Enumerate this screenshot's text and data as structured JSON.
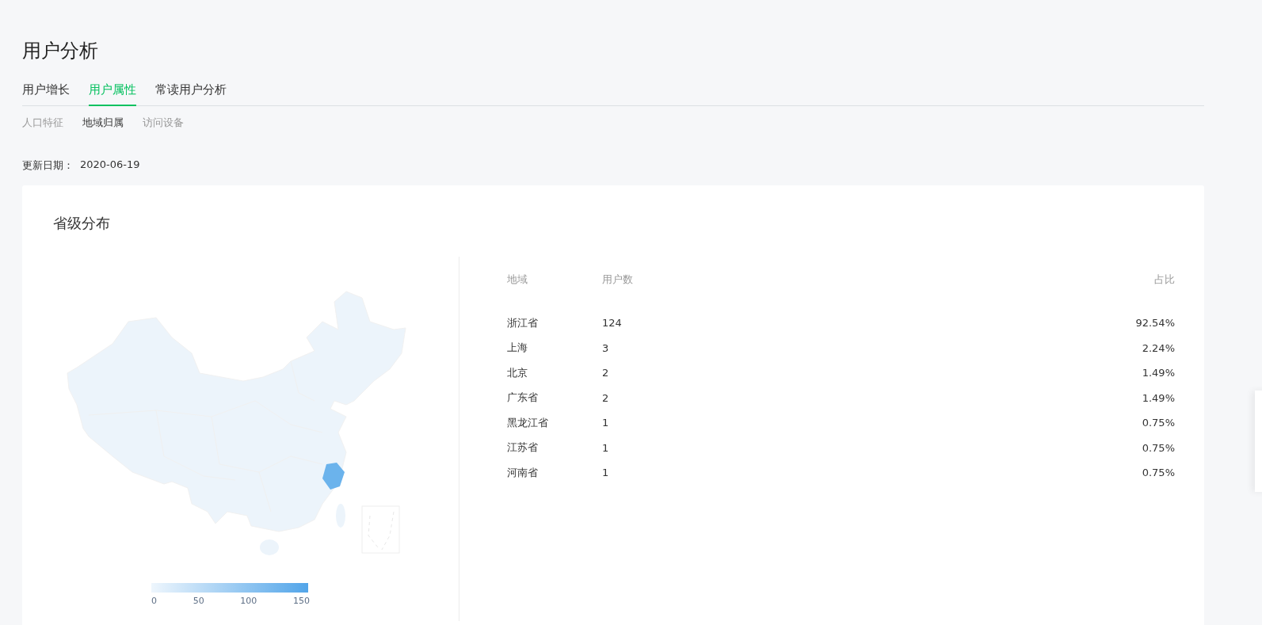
{
  "page_title": "用户分析",
  "tabs": [
    {
      "label": "用户增长",
      "selected": false
    },
    {
      "label": "用户属性",
      "selected": true
    },
    {
      "label": "常读用户分析",
      "selected": false
    }
  ],
  "subtabs": [
    {
      "label": "人口特征",
      "selected": false
    },
    {
      "label": "地域归属",
      "selected": true
    },
    {
      "label": "访问设备",
      "selected": false
    }
  ],
  "update": {
    "label": "更新日期：",
    "date": "2020-06-19"
  },
  "card": {
    "title": "省级分布",
    "map": {
      "legend_ticks": [
        "0",
        "50",
        "100",
        "150"
      ]
    },
    "table": {
      "columns": [
        "地域",
        "用户数",
        "占比"
      ],
      "rows": [
        {
          "region": "浙江省",
          "users": "124",
          "share": "92.54%"
        },
        {
          "region": "上海",
          "users": "3",
          "share": "2.24%"
        },
        {
          "region": "北京",
          "users": "2",
          "share": "1.49%"
        },
        {
          "region": "广东省",
          "users": "2",
          "share": "1.49%"
        },
        {
          "region": "黑龙江省",
          "users": "1",
          "share": "0.75%"
        },
        {
          "region": "江苏省",
          "users": "1",
          "share": "0.75%"
        },
        {
          "region": "河南省",
          "users": "1",
          "share": "0.75%"
        }
      ]
    }
  }
}
